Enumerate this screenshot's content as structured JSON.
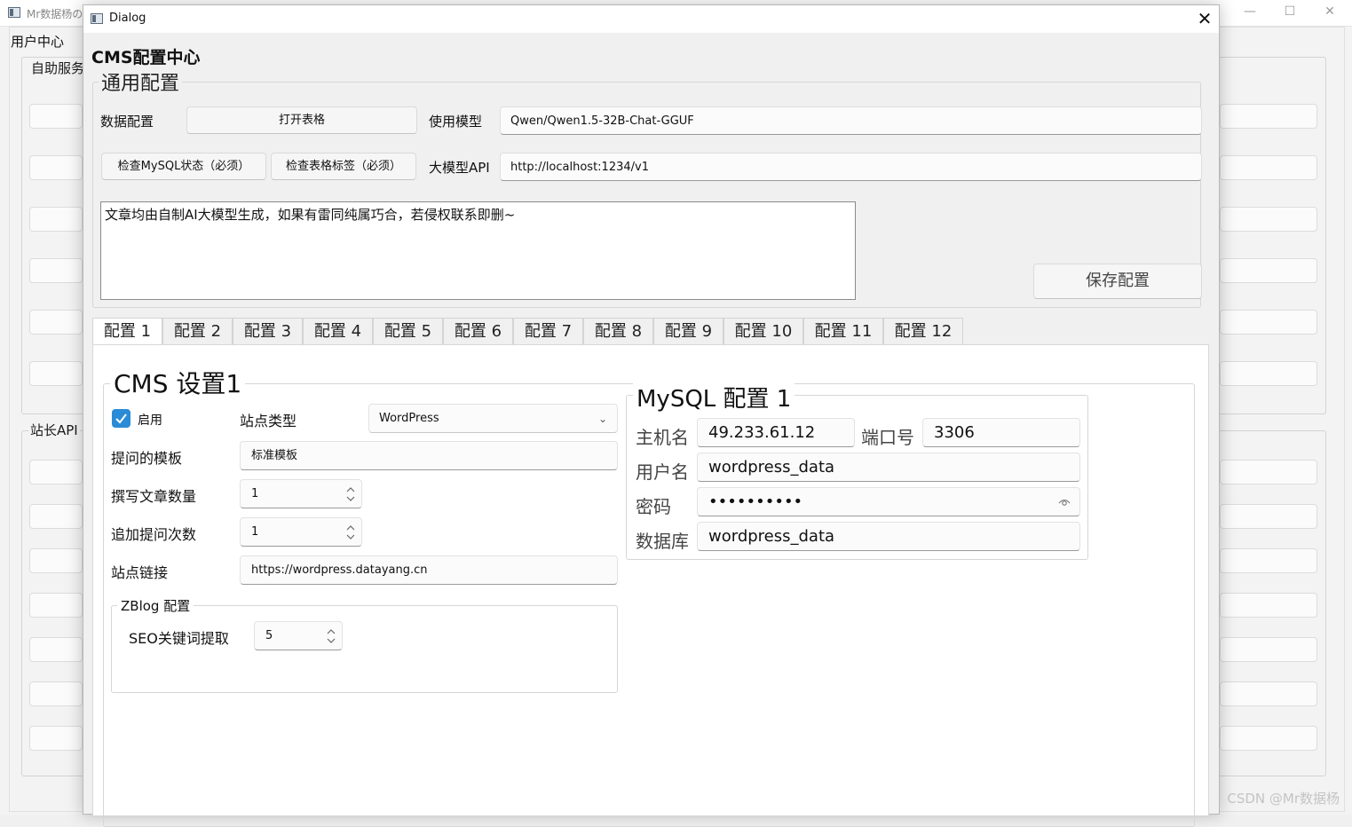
{
  "background_window": {
    "title": "Mr数据杨の",
    "menu": "用户中心",
    "group1_title": "自助服务",
    "group2_title": "站长API",
    "minimize_glyph": "—",
    "maximize_glyph": "☐",
    "close_glyph": "✕"
  },
  "dialog": {
    "title": "Dialog",
    "close_glyph": "✕",
    "heading": "CMS配置中心",
    "general": {
      "group_title": "通用配置",
      "data_config_label": "数据配置",
      "open_table_button": "打开表格",
      "model_label": "使用模型",
      "model_value": "Qwen/Qwen1.5-32B-Chat-GGUF",
      "check_mysql_button": "检查MySQL状态（必须）",
      "check_tags_button": "检查表格标签（必须）",
      "api_label": "大模型API",
      "api_value": "http://localhost:1234/v1",
      "notice_text": "文章均由自制AI大模型生成，如果有雷同纯属巧合，若侵权联系即删~",
      "save_button": "保存配置"
    },
    "tabs": [
      "配置 1",
      "配置 2",
      "配置 3",
      "配置 4",
      "配置 5",
      "配置 6",
      "配置 7",
      "配置 8",
      "配置 9",
      "配置 10",
      "配置 11",
      "配置 12"
    ],
    "active_tab": 0,
    "cms": {
      "group_title": "CMS 设置1",
      "enable_label": "启用",
      "enabled": true,
      "site_type_label": "站点类型",
      "site_type_value": "WordPress",
      "template_label": "提问的模板",
      "template_value": "标准模板",
      "article_count_label": "撰写文章数量",
      "article_count_value": "1",
      "followup_label": "追加提问次数",
      "followup_value": "1",
      "site_link_label": "站点链接",
      "site_link_value": "https://wordpress.datayang.cn",
      "zblog": {
        "group_title": "ZBlog 配置",
        "seo_label": "SEO关键词提取",
        "seo_value": "5"
      }
    },
    "mysql": {
      "group_title": "MySQL 配置 1",
      "host_label": "主机名",
      "host_value": "49.233.61.12",
      "port_label": "端口号",
      "port_value": "3306",
      "user_label": "用户名",
      "user_value": "wordpress_data",
      "password_label": "密码",
      "password_value": "••••••••••",
      "db_label": "数据库",
      "db_value": "wordpress_data"
    }
  },
  "watermark": "CSDN @Mr数据杨",
  "colors": {
    "accent": "#2a8bd6",
    "dialog_bg": "#f0f0f0",
    "panel_bg": "#ffffff"
  }
}
